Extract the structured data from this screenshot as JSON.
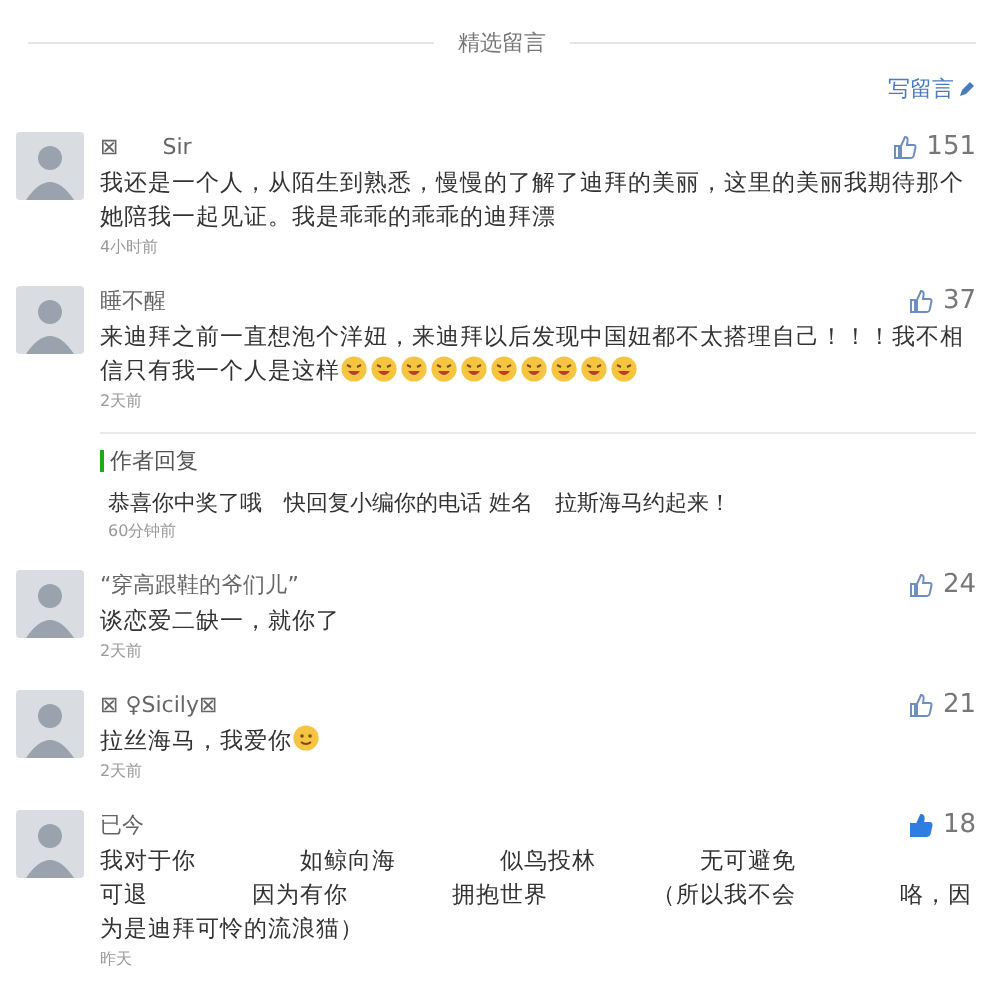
{
  "header": {
    "title": "精选留言",
    "write_link": "写留言"
  },
  "comments": [
    {
      "name": "⊠　　Sir",
      "likes": "151",
      "liked": false,
      "parts": [
        {
          "kind": "text",
          "text": "我还是一个人，从陌生到熟悉，慢慢的了解了迪拜的美丽，这里的美丽我期待那个她陪我一起见证。我是乖乖的乖乖的迪拜漂"
        }
      ],
      "time": "4小时前"
    },
    {
      "name": "睡不醒",
      "likes": "37",
      "liked": false,
      "parts": [
        {
          "kind": "text",
          "text": "来迪拜之前一直想泡个洋妞，来迪拜以后发现中国妞都不太搭理自己！！！我不相信只有我一个人是这样"
        },
        {
          "kind": "emoji"
        },
        {
          "kind": "emoji"
        },
        {
          "kind": "emoji"
        },
        {
          "kind": "emoji"
        },
        {
          "kind": "emoji"
        },
        {
          "kind": "emoji"
        },
        {
          "kind": "emoji"
        },
        {
          "kind": "emoji"
        },
        {
          "kind": "emoji"
        },
        {
          "kind": "emoji"
        }
      ],
      "time": "2天前",
      "reply": {
        "label": "作者回复",
        "text": "恭喜你中奖了哦　快回复小编你的电话 姓名　拉斯海马约起来！",
        "time": "60分钟前"
      }
    },
    {
      "name": "“穿高跟鞋的爷们儿”",
      "likes": "24",
      "liked": false,
      "parts": [
        {
          "kind": "text",
          "text": "谈恋爱二缺一，就你了"
        }
      ],
      "time": "2天前"
    },
    {
      "name": "⊠ ♀Sicily⊠",
      "likes": "21",
      "liked": false,
      "parts": [
        {
          "kind": "text",
          "text": "拉丝海马，我爱你"
        },
        {
          "kind": "smile"
        }
      ],
      "time": "2天前"
    },
    {
      "name": "已今",
      "likes": "18",
      "liked": true,
      "parts": [
        {
          "kind": "phrase",
          "text": "我对于你"
        },
        {
          "kind": "phrase",
          "text": "如鲸向海"
        },
        {
          "kind": "phrase",
          "text": "似鸟投林"
        },
        {
          "kind": "phrase",
          "text": "无可避免"
        },
        {
          "kind": "phrase",
          "text": "可退"
        },
        {
          "kind": "phrase",
          "text": "因为有你"
        },
        {
          "kind": "phrase",
          "text": "拥抱世界"
        },
        {
          "kind": "phrase",
          "text": "（所以我不会"
        },
        {
          "kind": "text",
          "text": "咯，因为是迪拜可怜的流浪猫）"
        }
      ],
      "time": "昨天"
    }
  ]
}
